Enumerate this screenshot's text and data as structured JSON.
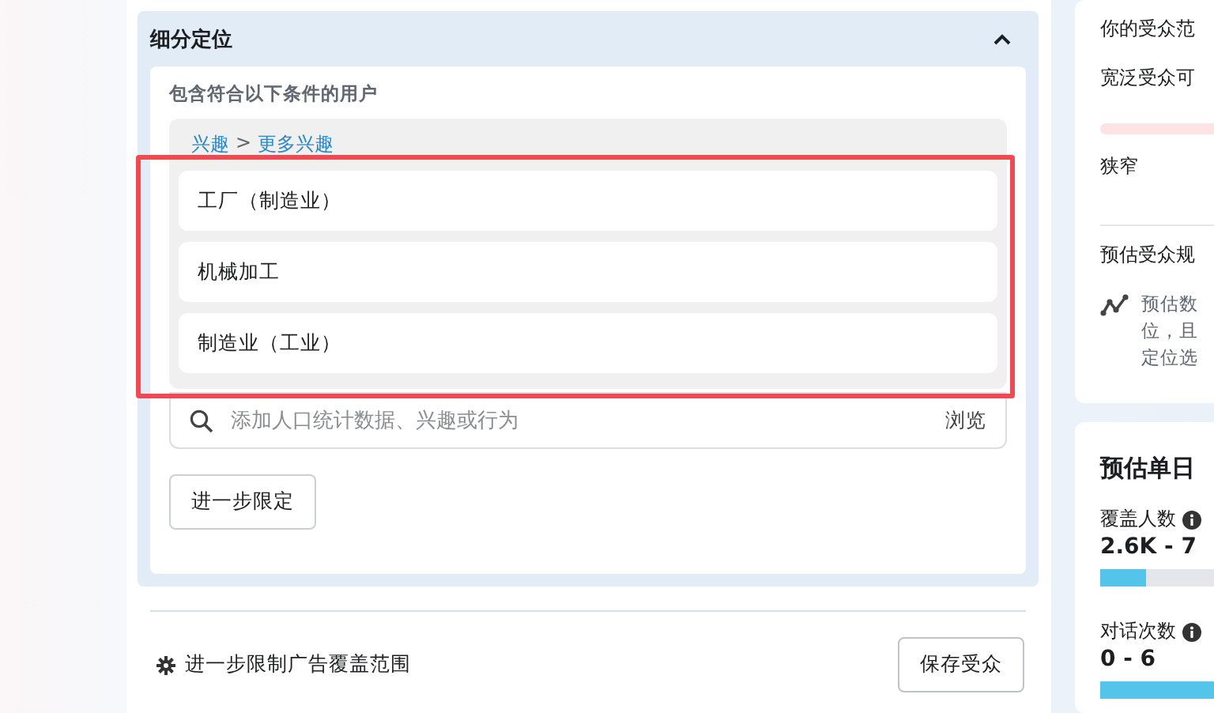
{
  "targeting": {
    "title": "细分定位",
    "expanded": true,
    "include_label": "包含符合以下条件的用户",
    "breadcrumb": [
      {
        "text": "兴趣"
      },
      {
        "text": ">"
      },
      {
        "text": "更多兴趣"
      }
    ],
    "items": [
      {
        "label": "工厂（制造业）"
      },
      {
        "label": "机械加工"
      },
      {
        "label": "制造业（工业）"
      }
    ],
    "search": {
      "placeholder": "添加人口统计数据、兴趣或行为",
      "browse": "浏览"
    },
    "narrow_button": "进一步限定"
  },
  "footer": {
    "link": "进一步限制广告覆盖范围",
    "save_button": "保存受众"
  },
  "audience": {
    "label": "你的受众范",
    "hint": "宽泛受众可",
    "narrow": "狭窄",
    "size_label": "预估受众规",
    "note": [
      "预估数",
      "位，且",
      "定位选"
    ]
  },
  "daily": {
    "title": "预估单日",
    "metrics": [
      {
        "label": "覆盖人数",
        "value": "2.6K - 7",
        "level": 0.4
      },
      {
        "label": "对话次数",
        "value": "0 - 6",
        "level": 1
      }
    ]
  }
}
